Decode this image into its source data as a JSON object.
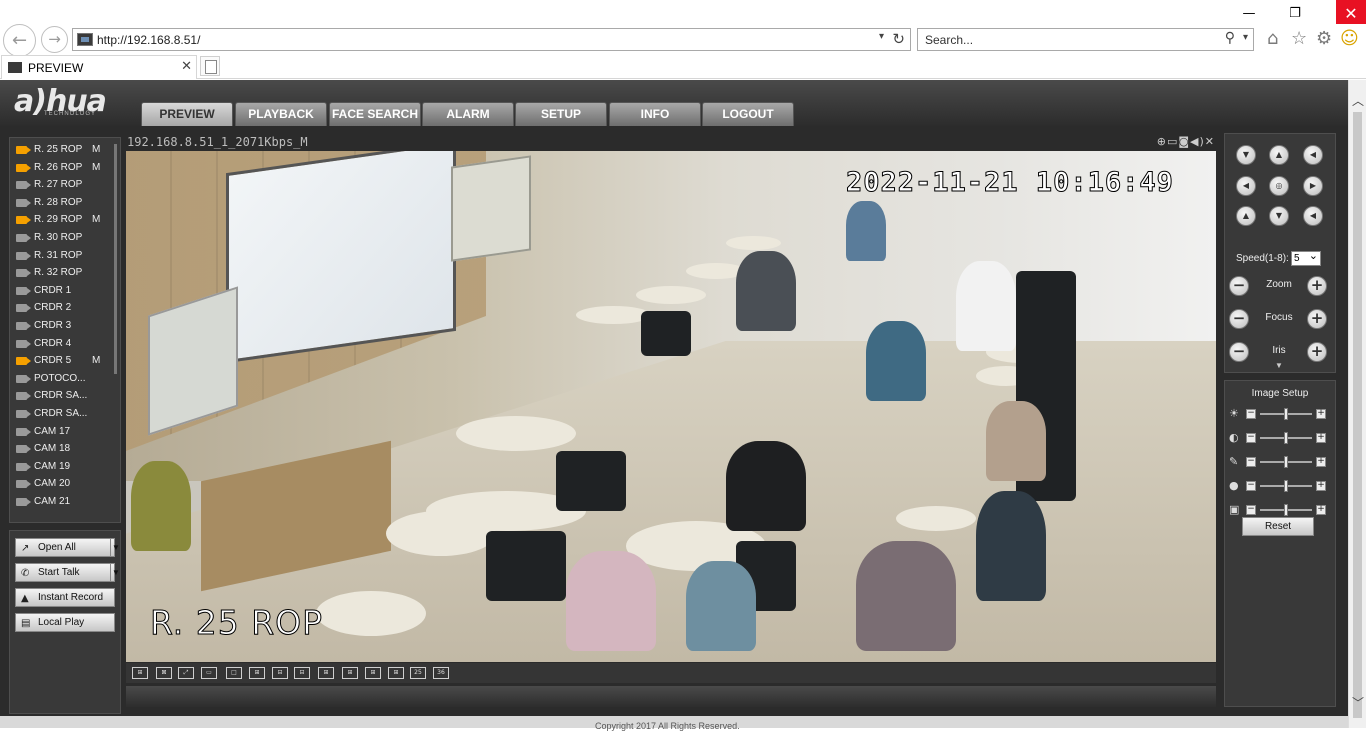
{
  "browser": {
    "window_controls": {
      "minimize": "—",
      "maximize": "❐",
      "close": "✕"
    },
    "back_icon": "←",
    "forward_icon": "→",
    "url": "http://192.168.8.51/",
    "url_dropdown": "▾",
    "refresh_icon": "↻",
    "search_placeholder": "Search...",
    "search_icon": "⚲",
    "search_dropdown": "▾",
    "toolbar_icons": {
      "home": "⌂",
      "favorites": "☆",
      "settings": "⚙",
      "feedback": "☺"
    },
    "tab": {
      "label": "PREVIEW",
      "close": "✕"
    }
  },
  "app": {
    "logo": "a)hua",
    "logo_sub": "TECHNOLOGY",
    "menu": [
      {
        "label": "PREVIEW",
        "active": true
      },
      {
        "label": "PLAYBACK",
        "active": false
      },
      {
        "label": "FACE SEARCH",
        "active": false
      },
      {
        "label": "ALARM",
        "active": false
      },
      {
        "label": "SETUP",
        "active": false
      },
      {
        "label": "INFO",
        "active": false
      },
      {
        "label": "LOGOUT",
        "active": false
      }
    ]
  },
  "channels": [
    {
      "label": "R. 25 ROP",
      "active": true,
      "mark": "M"
    },
    {
      "label": "R. 26 ROP",
      "active": true,
      "mark": "M"
    },
    {
      "label": "R. 27 ROP",
      "active": false,
      "mark": ""
    },
    {
      "label": "R. 28 ROP",
      "active": false,
      "mark": ""
    },
    {
      "label": "R. 29 ROP",
      "active": true,
      "mark": "M"
    },
    {
      "label": "R. 30 ROP",
      "active": false,
      "mark": ""
    },
    {
      "label": "R. 31 ROP",
      "active": false,
      "mark": ""
    },
    {
      "label": "R. 32 ROP",
      "active": false,
      "mark": ""
    },
    {
      "label": "CRDR 1",
      "active": false,
      "mark": ""
    },
    {
      "label": "CRDR 2",
      "active": false,
      "mark": ""
    },
    {
      "label": "CRDR 3",
      "active": false,
      "mark": ""
    },
    {
      "label": "CRDR 4",
      "active": false,
      "mark": ""
    },
    {
      "label": "CRDR 5",
      "active": true,
      "mark": "M"
    },
    {
      "label": "POTOCO...",
      "active": false,
      "mark": ""
    },
    {
      "label": "CRDR SA...",
      "active": false,
      "mark": ""
    },
    {
      "label": "CRDR SA...",
      "active": false,
      "mark": ""
    },
    {
      "label": "CAM 17",
      "active": false,
      "mark": ""
    },
    {
      "label": "CAM 18",
      "active": false,
      "mark": ""
    },
    {
      "label": "CAM 19",
      "active": false,
      "mark": ""
    },
    {
      "label": "CAM 20",
      "active": false,
      "mark": ""
    },
    {
      "label": "CAM 21",
      "active": false,
      "mark": ""
    }
  ],
  "controls": {
    "open_all": "Open All",
    "start_talk": "Start Talk",
    "instant_record": "Instant Record",
    "local_play": "Local Play",
    "dropdown": "▼",
    "icons": {
      "open_all": "↗",
      "start_talk": "✆",
      "instant_record": "▲",
      "local_play": "▤"
    }
  },
  "video": {
    "title": "192.168.8.51_1_2071Kbps_M",
    "tools": "⊕▭◙◀)✕",
    "timestamp": "2022-11-21 10:16:49",
    "caption": "R. 25 ROP",
    "layouts": [
      "⊞",
      "⊠",
      "⤢",
      "▭",
      "□",
      "⊞",
      "⊟",
      "⊟",
      "⊞",
      "⊞",
      "⊞",
      "⊞",
      "25",
      "36"
    ]
  },
  "ptz": {
    "arrows": [
      "▼",
      "▲",
      "◀",
      "◀",
      "◎",
      "▶",
      "▲",
      "▼",
      "◀"
    ],
    "speed_label": "Speed(1-8):",
    "speed_value": "5",
    "minus": "−",
    "plus": "+",
    "zoom_label": "Zoom",
    "focus_label": "Focus",
    "iris_label": "Iris",
    "collapse": "▼"
  },
  "image_setup": {
    "title": "Image Setup",
    "rows": [
      {
        "icon": "☀",
        "value": 0.5
      },
      {
        "icon": "◐",
        "value": 0.5
      },
      {
        "icon": "✎",
        "value": 0.5
      },
      {
        "icon": "●",
        "value": 0.5
      },
      {
        "icon": "▣",
        "value": 0.5
      }
    ],
    "minus": "−",
    "plus": "+",
    "reset": "Reset"
  },
  "footer": {
    "text": "Copyright 2017 All Rights Reserved."
  },
  "scrollbar": {
    "up": "︿",
    "down": "﹀"
  }
}
